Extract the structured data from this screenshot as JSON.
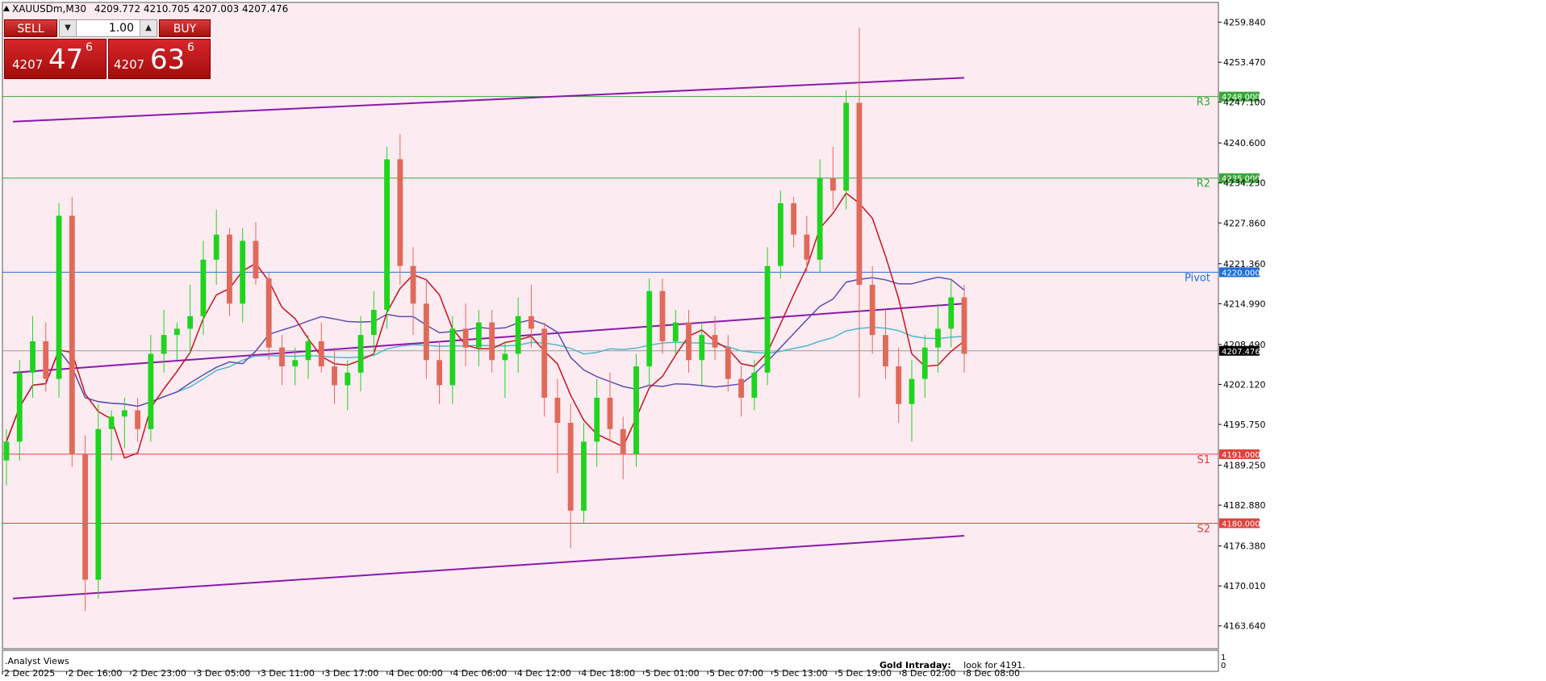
{
  "header": {
    "symbol_label": "XAUUSDm,M30",
    "ohlc_label": "4209.772 4210.705 4207.003 4207.476"
  },
  "trade_panel": {
    "sell_label": "SELL",
    "buy_label": "BUY",
    "lot_value": "1.00",
    "sell_price": {
      "small": "4207",
      "big": "47",
      "sup": "6"
    },
    "buy_price": {
      "small": "4207",
      "big": "63",
      "sup": "6"
    }
  },
  "chart_data": {
    "type": "candlestick",
    "symbol": "XAUUSDm",
    "timeframe": "M30",
    "current_price": 4207.476,
    "ylim": [
      4160,
      4263
    ],
    "y_ticks": [
      "4259.840",
      "4253.470",
      "4247.100",
      "4240.600",
      "4234.230",
      "4227.860",
      "4221.360",
      "4214.990",
      "4208.490",
      "4202.120",
      "4195.750",
      "4189.250",
      "4182.880",
      "4176.380",
      "4170.010",
      "4163.640"
    ],
    "x_ticks": [
      "2 Dec 2025",
      "2 Dec 16:00",
      "2 Dec 23:00",
      "3 Dec 05:00",
      "3 Dec 11:00",
      "3 Dec 17:00",
      "4 Dec 00:00",
      "4 Dec 06:00",
      "4 Dec 12:00",
      "4 Dec 18:00",
      "5 Dec 01:00",
      "5 Dec 07:00",
      "5 Dec 13:00",
      "5 Dec 19:00",
      "8 Dec 02:00",
      "8 Dec 08:00"
    ],
    "levels": [
      {
        "name": "R3",
        "price": 4248.0,
        "label": "4248.000",
        "color": "#3aa83a"
      },
      {
        "name": "R2",
        "price": 4235.0,
        "label": "4235.000",
        "color": "#3aa83a"
      },
      {
        "name": "Pivot",
        "price": 4220.0,
        "label": "4220.000",
        "color": "#1e6fd9"
      },
      {
        "name": "S1",
        "price": 4191.0,
        "label": "4191.000",
        "color": "#e0413c"
      },
      {
        "name": "S2",
        "price": 4180.0,
        "label": "4180.000",
        "color": "#e0413c"
      }
    ],
    "candles": [
      [
        4190,
        4195,
        4186,
        4193
      ],
      [
        4193,
        4206,
        4190,
        4204
      ],
      [
        4204,
        4213,
        4200,
        4209
      ],
      [
        4209,
        4212,
        4201,
        4203
      ],
      [
        4203,
        4231,
        4200,
        4229
      ],
      [
        4229,
        4232,
        4189,
        4191
      ],
      [
        4191,
        4194,
        4166,
        4171
      ],
      [
        4171,
        4199,
        4168,
        4195
      ],
      [
        4195,
        4198,
        4190,
        4197
      ],
      [
        4197,
        4200,
        4192,
        4198
      ],
      [
        4198,
        4200,
        4193,
        4195
      ],
      [
        4195,
        4210,
        4193,
        4207
      ],
      [
        4207,
        4214,
        4204,
        4210
      ],
      [
        4210,
        4212,
        4206,
        4211
      ],
      [
        4211,
        4218,
        4207,
        4213
      ],
      [
        4213,
        4225,
        4210,
        4222
      ],
      [
        4222,
        4230,
        4218,
        4226
      ],
      [
        4226,
        4227,
        4213,
        4215
      ],
      [
        4215,
        4227,
        4212,
        4225
      ],
      [
        4225,
        4228,
        4218,
        4219
      ],
      [
        4219,
        4220,
        4206,
        4208
      ],
      [
        4208,
        4210,
        4202,
        4205
      ],
      [
        4205,
        4208,
        4202,
        4206
      ],
      [
        4206,
        4210,
        4203,
        4209
      ],
      [
        4209,
        4212,
        4204,
        4205
      ],
      [
        4205,
        4208,
        4199,
        4202
      ],
      [
        4202,
        4206,
        4198,
        4204
      ],
      [
        4204,
        4213,
        4201,
        4210
      ],
      [
        4210,
        4217,
        4207,
        4214
      ],
      [
        4214,
        4240,
        4211,
        4238
      ],
      [
        4238,
        4242,
        4218,
        4221
      ],
      [
        4221,
        4224,
        4210,
        4215
      ],
      [
        4215,
        4219,
        4203,
        4206
      ],
      [
        4206,
        4209,
        4199,
        4202
      ],
      [
        4202,
        4213,
        4199,
        4211
      ],
      [
        4211,
        4215,
        4205,
        4208
      ],
      [
        4208,
        4214,
        4205,
        4212
      ],
      [
        4212,
        4214,
        4204,
        4206
      ],
      [
        4206,
        4209,
        4200,
        4207
      ],
      [
        4207,
        4216,
        4204,
        4213
      ],
      [
        4213,
        4218,
        4208,
        4211
      ],
      [
        4211,
        4212,
        4197,
        4200
      ],
      [
        4200,
        4203,
        4188,
        4196
      ],
      [
        4196,
        4199,
        4176,
        4182
      ],
      [
        4182,
        4196,
        4180,
        4193
      ],
      [
        4193,
        4203,
        4189,
        4200
      ],
      [
        4200,
        4204,
        4193,
        4195
      ],
      [
        4195,
        4197,
        4187,
        4191
      ],
      [
        4191,
        4207,
        4189,
        4205
      ],
      [
        4205,
        4219,
        4202,
        4217
      ],
      [
        4217,
        4219,
        4207,
        4209
      ],
      [
        4209,
        4214,
        4207,
        4212
      ],
      [
        4212,
        4214,
        4204,
        4206
      ],
      [
        4206,
        4212,
        4202,
        4210
      ],
      [
        4210,
        4213,
        4206,
        4208
      ],
      [
        4208,
        4210,
        4201,
        4203
      ],
      [
        4203,
        4205,
        4197,
        4200
      ],
      [
        4200,
        4206,
        4198,
        4204
      ],
      [
        4204,
        4224,
        4202,
        4221
      ],
      [
        4221,
        4233,
        4219,
        4231
      ],
      [
        4231,
        4232,
        4224,
        4226
      ],
      [
        4226,
        4229,
        4220,
        4222
      ],
      [
        4222,
        4238,
        4220,
        4235
      ],
      [
        4235,
        4240,
        4230,
        4233
      ],
      [
        4233,
        4249,
        4230,
        4247
      ],
      [
        4247,
        4259,
        4200,
        4218
      ],
      [
        4218,
        4221,
        4207,
        4210
      ],
      [
        4210,
        4214,
        4203,
        4205
      ],
      [
        4205,
        4208,
        4196,
        4199
      ],
      [
        4199,
        4206,
        4193,
        4203
      ],
      [
        4203,
        4210,
        4200,
        4208
      ],
      [
        4208,
        4215,
        4204,
        4211
      ],
      [
        4211,
        4219,
        4208,
        4216
      ],
      [
        4216,
        4218,
        4204,
        4207
      ]
    ],
    "ma_red_color": "#c9141a",
    "ma_blue_color": "#5b4fb0",
    "ma_cyan_color": "#4fb8c9",
    "channel_color": "#8a1aa8",
    "upper_channel": [
      [
        0,
        4244
      ],
      [
        73,
        4251
      ]
    ],
    "middle_channel": [
      [
        0,
        4204
      ],
      [
        73,
        4215
      ]
    ],
    "lower_channel": [
      [
        0,
        4168
      ],
      [
        73,
        4178
      ]
    ],
    "bull_color": "#1fd41f",
    "bear_color": "#e06a5a"
  },
  "footer": {
    "analyst_label": ".Analyst Views",
    "note_title": "Gold Intraday:",
    "note_text": "look for 4191.",
    "sub_scale_top": "1",
    "sub_scale_bottom": "0"
  }
}
